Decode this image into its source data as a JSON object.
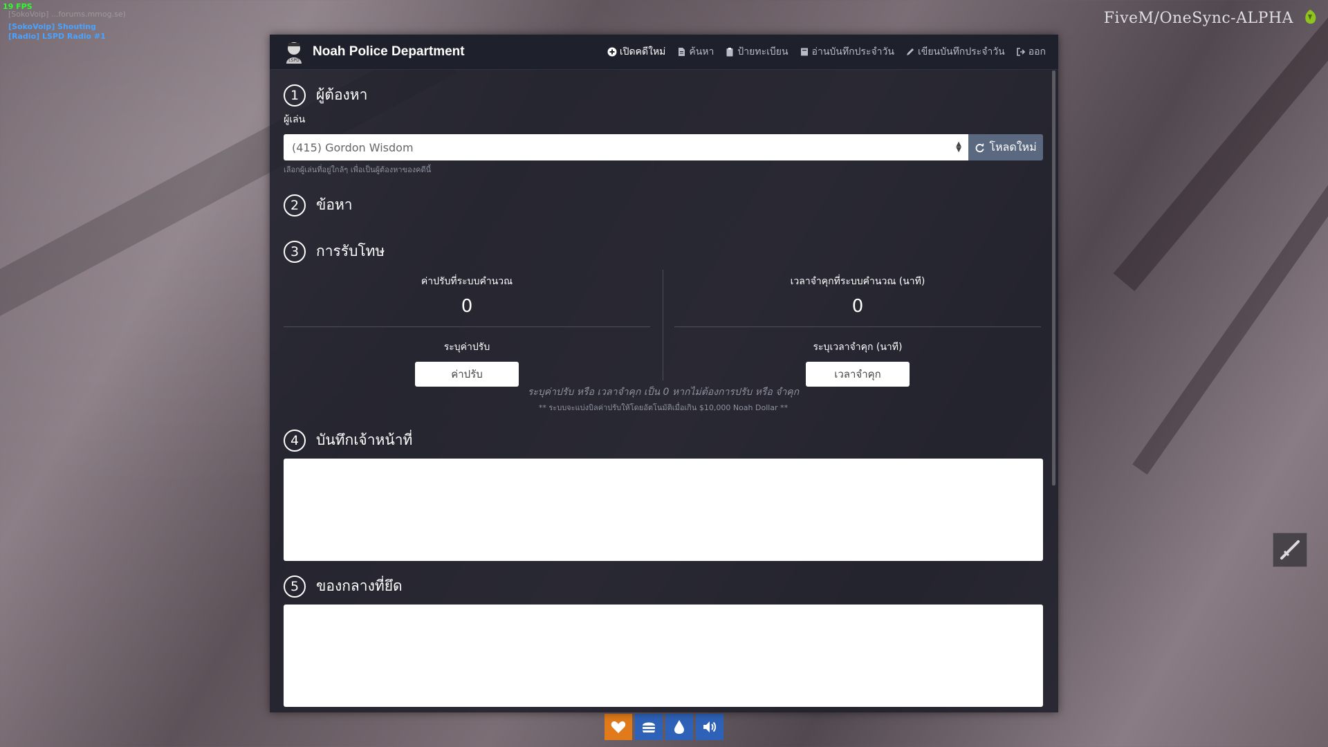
{
  "hud": {
    "fps": "19 FPS",
    "line0": "[SokoVoip] ...forums.mmog.se)",
    "line1": "[SokoVoip] Shouting",
    "line2": "[Radio] LSPD Radio #1",
    "brand": "FiveM/OneSync-ALPHA"
  },
  "nav": {
    "title": "Noah Police Department",
    "items": [
      {
        "label": "เปิดคดีใหม่",
        "icon": "plus-circle-icon"
      },
      {
        "label": "ค้นหา",
        "icon": "file-icon"
      },
      {
        "label": "ป้ายทะเบียน",
        "icon": "clipboard-icon"
      },
      {
        "label": "อ่านบันทึกประจำวัน",
        "icon": "book-icon"
      },
      {
        "label": "เขียนบันทึกประจำวัน",
        "icon": "pencil-icon"
      },
      {
        "label": "ออก",
        "icon": "sign-out-icon"
      }
    ]
  },
  "sections": {
    "s1": {
      "num": "1",
      "title": "ผู้ต้องหา",
      "label": "ผู้เล่น",
      "selected": "(415) Gordon Wisdom",
      "reload": "โหลดใหม่",
      "help": "เลือกผู้เล่นที่อยู่ใกล้ๆ เพื่อเป็นผู้ต้องหาของคดีนี้"
    },
    "s2": {
      "num": "2",
      "title": "ข้อหา"
    },
    "s3": {
      "num": "3",
      "title": "การรับโทษ",
      "fine_caption": "ค่าปรับที่ระบบคำนวณ",
      "fine_value": "0",
      "jail_caption": "เวลาจำคุกที่ระบบคำนวณ (นาที)",
      "jail_value": "0",
      "fine_input_caption": "ระบุค่าปรับ",
      "fine_input_placeholder": "ค่าปรับ",
      "jail_input_caption": "ระบุเวลาจำคุก (นาที)",
      "jail_input_placeholder": "เวลาจำคุก",
      "note": "ระบุค่าปรับ หรือ เวลาจำคุก เป็น 0 หากไม่ต้องการปรับ หรือ จำคุก",
      "note2": "** ระบบจะแบ่งบิลค่าปรับให้โดยอัตโนมัติเมื่อเกิน $10,000 Noah Dollar **"
    },
    "s4": {
      "num": "4",
      "title": "บันทึกเจ้าหน้าที่"
    },
    "s5": {
      "num": "5",
      "title": "ของกลางที่ยึด"
    }
  },
  "colors": {
    "nav_bg": "#1e202b",
    "panel_bg": "#1e1f2a",
    "reload_btn": "#5a6880",
    "health": "#e07a1b",
    "status_blue": "#2e62b8"
  }
}
